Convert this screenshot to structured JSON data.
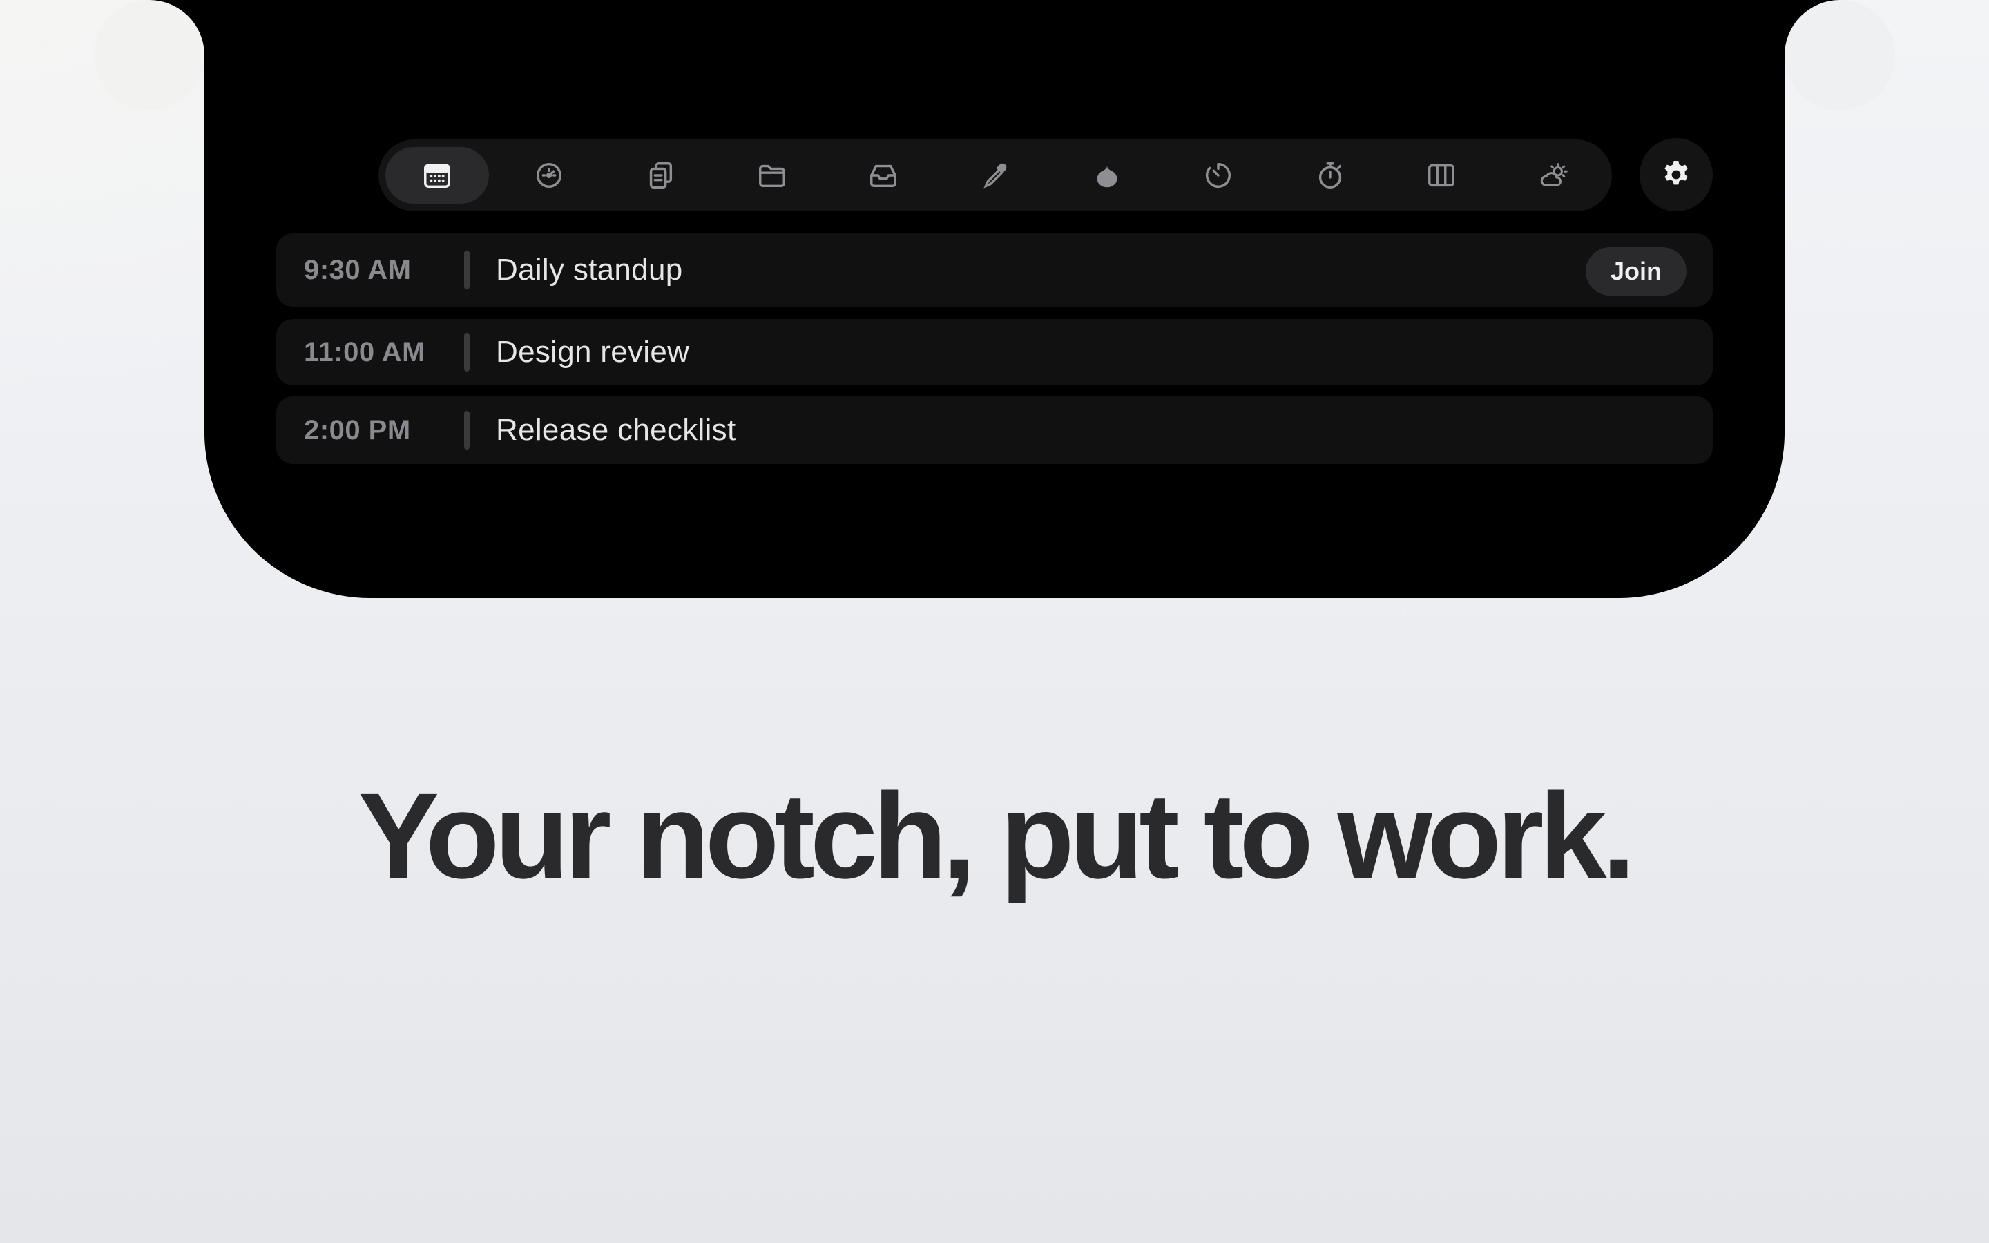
{
  "toolbar": {
    "tools": [
      {
        "icon": "calendar-icon",
        "active": true
      },
      {
        "icon": "gauge-icon",
        "active": false
      },
      {
        "icon": "clipboard-icon",
        "active": false
      },
      {
        "icon": "folder-icon",
        "active": false
      },
      {
        "icon": "inbox-tray-icon",
        "active": false
      },
      {
        "icon": "eyedropper-icon",
        "active": false
      },
      {
        "icon": "drop-icon",
        "active": false
      },
      {
        "icon": "timer-icon",
        "active": false
      },
      {
        "icon": "stopwatch-icon",
        "active": false
      },
      {
        "icon": "columns-icon",
        "active": false
      },
      {
        "icon": "cloud-sun-icon",
        "active": false
      }
    ],
    "settings_icon": "gear-icon"
  },
  "events": [
    {
      "time": "9:30 AM",
      "title": "Daily standup",
      "action": "Join"
    },
    {
      "time": "11:00 AM",
      "title": "Design review"
    },
    {
      "time": "2:00 PM",
      "title": "Release checklist"
    }
  ],
  "headline": "Your notch, put to work.",
  "colors": {
    "notch_bg": "#000000",
    "toolbar_bg": "#141414",
    "active_tool_bg": "#2a2a2c",
    "headline_text": "#2a2a2c"
  }
}
